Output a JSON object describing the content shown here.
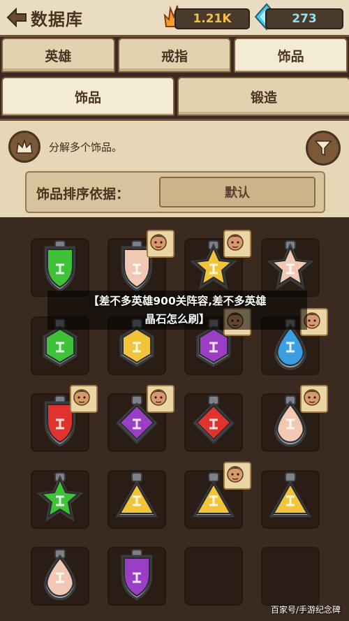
{
  "header": {
    "title": "数据库",
    "gold": "1.21K",
    "gems": "273"
  },
  "tabs_primary": [
    "英雄",
    "戒指",
    "饰品"
  ],
  "tabs_secondary": [
    "饰品",
    "锻造"
  ],
  "panel": {
    "dismantle_text": "分解多个饰品。",
    "sort_label": "饰品排序依据：",
    "sort_value": "默认"
  },
  "overlay": {
    "headline_line1": "【差不多英雄900关阵容,差不多英雄",
    "headline_line2": "晶石怎么刷】",
    "watermark": "百家号/手游纪念碑"
  },
  "colors": {
    "green": "#3fc23a",
    "gold": "#f2c43a",
    "purple": "#9b3ec6",
    "blue": "#3a9ee0",
    "red": "#e0322e",
    "peach": "#f0c8b4"
  },
  "inventory": [
    {
      "shape": "shield",
      "color": "green",
      "portrait": false
    },
    {
      "shape": "shield",
      "color": "peach",
      "portrait": true
    },
    {
      "shape": "star",
      "color": "gold",
      "portrait": true
    },
    {
      "shape": "star",
      "color": "peach",
      "portrait": false
    },
    {
      "shape": "hex",
      "color": "green",
      "portrait": false
    },
    {
      "shape": "hex",
      "color": "gold",
      "portrait": false
    },
    {
      "shape": "hex",
      "color": "purple",
      "portrait": true
    },
    {
      "shape": "drop",
      "color": "blue",
      "portrait": true
    },
    {
      "shape": "shield",
      "color": "red",
      "portrait": true
    },
    {
      "shape": "diamond",
      "color": "purple",
      "portrait": true
    },
    {
      "shape": "diamond",
      "color": "red",
      "portrait": false
    },
    {
      "shape": "drop",
      "color": "peach",
      "portrait": true
    },
    {
      "shape": "star",
      "color": "green",
      "portrait": false
    },
    {
      "shape": "tri",
      "color": "gold",
      "portrait": false
    },
    {
      "shape": "tri",
      "color": "gold",
      "portrait": true
    },
    {
      "shape": "tri",
      "color": "gold",
      "portrait": false
    },
    {
      "shape": "drop",
      "color": "peach",
      "portrait": false
    },
    {
      "shape": "shield",
      "color": "purple",
      "portrait": false
    },
    {
      "shape": "empty",
      "color": "",
      "portrait": false
    },
    {
      "shape": "empty",
      "color": "",
      "portrait": false
    }
  ]
}
